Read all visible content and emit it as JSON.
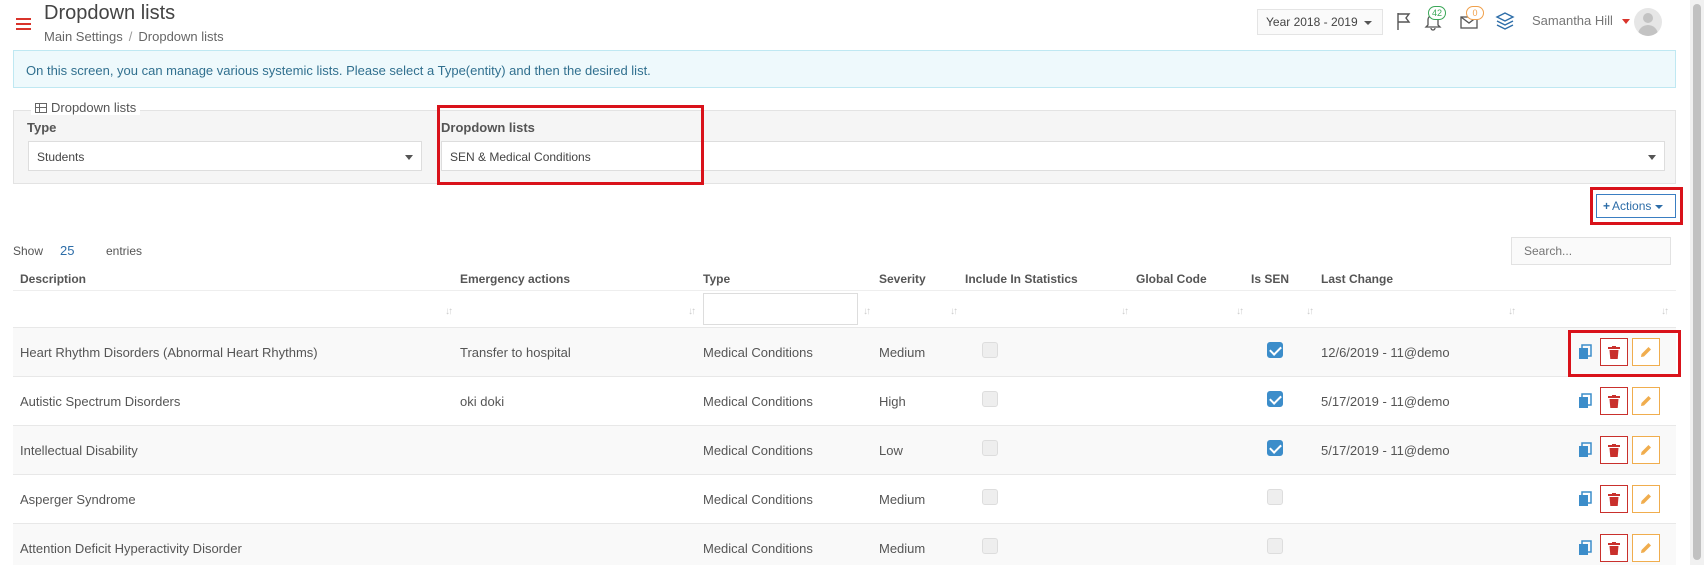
{
  "header": {
    "title": "Dropdown lists",
    "breadcrumb": [
      "Main Settings",
      "Dropdown lists"
    ],
    "year": "Year 2018 - 2019",
    "notifications_count": "42",
    "messages_count": "0",
    "user_name": "Samantha Hill"
  },
  "info": "On this screen, you can manage various systemic lists. Please select a Type(entity) and then the desired list.",
  "filters": {
    "legend": "Dropdown lists",
    "type_label": "Type",
    "type_value": "Students",
    "list_label": "Dropdown lists",
    "list_value": "SEN & Medical Conditions"
  },
  "actions_label": "Actions",
  "table": {
    "show_label": "Show",
    "page_size": "25",
    "entries_label": "entries",
    "search_placeholder": "Search...",
    "columns": [
      "Description",
      "Emergency actions",
      "Type",
      "Severity",
      "Include In Statistics",
      "Global Code",
      "Is SEN",
      "Last Change"
    ],
    "rows": [
      {
        "description": "Heart Rhythm Disorders (Abnormal Heart Rhythms)",
        "emergency": "Transfer to hospital",
        "type": "Medical Conditions",
        "severity": "Medium",
        "include_stats": false,
        "is_sen": true,
        "last_change": "12/6/2019 - 11@demo"
      },
      {
        "description": "Autistic Spectrum Disorders",
        "emergency": "oki doki",
        "type": "Medical Conditions",
        "severity": "High",
        "include_stats": false,
        "is_sen": true,
        "last_change": "5/17/2019 - 11@demo"
      },
      {
        "description": "Intellectual Disability",
        "emergency": "",
        "type": "Medical Conditions",
        "severity": "Low",
        "include_stats": false,
        "is_sen": true,
        "last_change": "5/17/2019 - 11@demo"
      },
      {
        "description": "Asperger Syndrome",
        "emergency": "",
        "type": "Medical Conditions",
        "severity": "Medium",
        "include_stats": false,
        "is_sen": false,
        "last_change": ""
      },
      {
        "description": "Attention Deficit Hyperactivity Disorder",
        "emergency": "",
        "type": "Medical Conditions",
        "severity": "Medium",
        "include_stats": false,
        "is_sen": false,
        "last_change": ""
      }
    ]
  },
  "colors": {
    "accent": "#3c8dca",
    "highlight": "#d9121a",
    "delete": "#c9302c",
    "edit": "#f0ad4e"
  },
  "icons": [
    "hamburger-icon",
    "flag-icon",
    "bell-icon",
    "envelope-icon",
    "layers-icon",
    "table-icon",
    "copy-icon",
    "trash-icon",
    "pencil-icon"
  ]
}
